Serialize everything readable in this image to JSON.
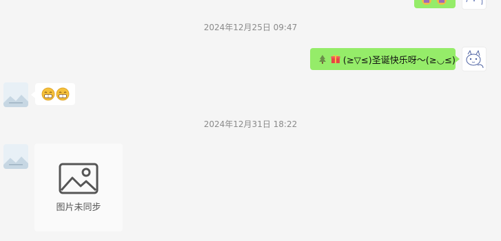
{
  "conversation": {
    "messages": [
      {
        "timestamp": "2024年12月25日 09:47"
      },
      {
        "sender": "self",
        "text": "(≥▽≤)圣诞快乐呀～(≥◡≤)",
        "emojis": [
          "christmas-tree",
          "gift"
        ]
      },
      {
        "sender": "other",
        "emojis": [
          "grin",
          "grin"
        ]
      },
      {
        "timestamp": "2024年12月31日 18:22"
      },
      {
        "sender": "other",
        "image": {
          "placeholder_text": "图片未同步"
        }
      }
    ]
  },
  "ui": {
    "ts1": "2024年12月25日 09:47",
    "msg_text": "(≥▽≤)圣诞快乐呀～(≥◡≤)",
    "ts2": "2024年12月31日 18:22",
    "image_placeholder": "图片未同步"
  },
  "icons": [
    "christmas-tree-icon",
    "gift-icon",
    "grin-emoji-icon",
    "image-icon"
  ],
  "colors": {
    "self_bubble": "#95ec69",
    "background": "#f5f5f5",
    "other_bubble": "#ffffff",
    "timestamp_text": "#8a8a8a"
  }
}
